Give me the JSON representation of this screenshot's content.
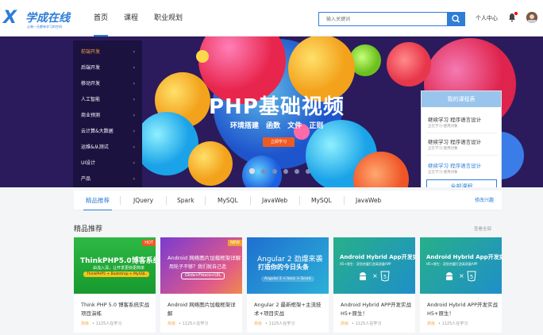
{
  "header": {
    "logo": {
      "name": "学成在线",
      "slogan": "让每一天都有学习的空间"
    },
    "nav": [
      "首页",
      "课程",
      "职业规划"
    ],
    "search_placeholder": "输入关键词",
    "user_center": "个人中心"
  },
  "sidebar": {
    "items": [
      "前端开发",
      "后端开发",
      "移动开发",
      "人工智能",
      "商业预测",
      "云计算&大数据",
      "运维&从测试",
      "UI设计",
      "产品"
    ]
  },
  "banner": {
    "title": "PHP基础视频",
    "subtitle": "环境搭建 函数 文件 正则",
    "button": "立即学习"
  },
  "schedule": {
    "title": "我的课程表",
    "items": [
      {
        "title": "继续学习 程序语言设计",
        "meta": "正在学习-使用对象"
      },
      {
        "title": "继续学习 程序语言设计",
        "meta": "正在学习-使用对象"
      },
      {
        "title": "继续学习 程序语言设计",
        "meta": "正在学习-使用对象"
      }
    ],
    "all_button": "全部课程"
  },
  "tabs": {
    "items": [
      "精品推荐",
      "JQuery",
      "Spark",
      "MySQL",
      "JavaWeb",
      "MySQL",
      "JavaWeb"
    ],
    "edit": "修改兴趣"
  },
  "section": {
    "title": "精品推荐",
    "view_all": "查看全部"
  },
  "cards": [
    {
      "title": "Think PHP 5.0 博客系统实战项目演练",
      "level": "高级",
      "learners": "1125人在学习",
      "tag": "HOT",
      "thumb_title": "ThinkPHP5.0博客系统实战",
      "thumb_sub": "由浅入深，让开发更快更简单",
      "thumb_pill": "ThinkPHP5 + Bootstrap + MySQL"
    },
    {
      "title": "Android 网络图片加载框架详解",
      "level": "高级",
      "learners": "1125人在学习",
      "tag": "NEW",
      "thumb_title": "Android 网络图片加载框架详解",
      "thumb_sub": "用轮子不够？我们就自己造",
      "thumb_pill": "Glide+Fresco+UIL"
    },
    {
      "title": "Angular 2 最新框架+主流技术+项目实战",
      "level": "高级",
      "learners": "1125人在学习",
      "tag": "",
      "thumb_title": "Angular 2 劲爆来袭",
      "thumb_sub": "打造你的今日头条",
      "thumb_pill": "Angular 2 + Ionic + Grunt"
    },
    {
      "title": "Android Hybrid APP开发实战 H5+原生！",
      "level": "高级",
      "learners": "1125人在学习",
      "tag": "",
      "thumb_title": "Android Hybrid App开发实战",
      "thumb_sub": "H5+原生：双剑合璧打造高质量APP",
      "thumb_pill": ""
    },
    {
      "title": "Android Hybrid APP开发实战 H5+原生！",
      "level": "高级",
      "learners": "1125人在学习",
      "tag": "",
      "thumb_title": "Android Hybrid App开发实战",
      "thumb_sub": "H5+原生：双剑合璧打造高质量APP",
      "thumb_pill": ""
    }
  ],
  "colors": {
    "accent": "#2e7dd6",
    "banner_bg": "#2b1b5c",
    "cta": "#f05a23",
    "hot": "#f05a23",
    "new": "#f0a030"
  }
}
